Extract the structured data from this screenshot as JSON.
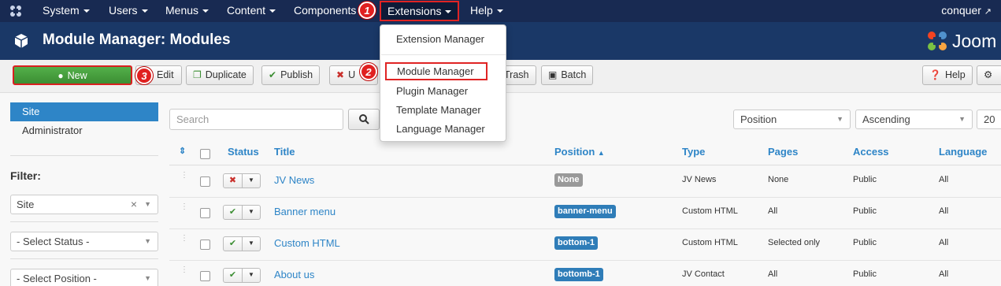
{
  "navbar": {
    "items": [
      {
        "label": "System"
      },
      {
        "label": "Users"
      },
      {
        "label": "Menus"
      },
      {
        "label": "Content"
      },
      {
        "label": "Components"
      },
      {
        "label": "Extensions"
      },
      {
        "label": "Help"
      }
    ],
    "user": "conquer"
  },
  "header": {
    "title": "Module Manager: Modules",
    "brand": "Joom"
  },
  "toolbar": {
    "new": "New",
    "edit": "Edit",
    "duplicate": "Duplicate",
    "publish": "Publish",
    "unpublish": "U",
    "trash": "Trash",
    "batch": "Batch",
    "help": "Help"
  },
  "steps": [
    "1",
    "2",
    "3"
  ],
  "dropdown": {
    "items": [
      "Extension Manager",
      "Module Manager",
      "Plugin Manager",
      "Template Manager",
      "Language Manager"
    ]
  },
  "sidebar": {
    "items": [
      "Site",
      "Administrator"
    ],
    "filter_label": "Filter:",
    "client_select": "Site",
    "status_select": "- Select Status -",
    "position_select": "- Select Position -"
  },
  "search": {
    "placeholder": "Search"
  },
  "list_controls": {
    "ordering": "Position",
    "direction": "Ascending",
    "limit": "20"
  },
  "table": {
    "headers": {
      "status": "Status",
      "title": "Title",
      "position": "Position",
      "type": "Type",
      "pages": "Pages",
      "access": "Access",
      "language": "Language"
    },
    "rows": [
      {
        "title": "JV News",
        "position": "None",
        "type": "JV News",
        "pages": "None",
        "access": "Public",
        "language": "All",
        "status": "unpublished"
      },
      {
        "title": "Banner menu",
        "position": "banner-menu",
        "type": "Custom HTML",
        "pages": "All",
        "access": "Public",
        "language": "All",
        "status": "published"
      },
      {
        "title": "Custom HTML",
        "position": "bottom-1",
        "type": "Custom HTML",
        "pages": "Selected only",
        "access": "Public",
        "language": "All",
        "status": "published"
      },
      {
        "title": "About us",
        "position": "bottomb-1",
        "type": "JV Contact",
        "pages": "All",
        "access": "Public",
        "language": "All",
        "status": "published"
      }
    ]
  },
  "colors": {
    "navbar": "#182a52",
    "header": "#1a3867",
    "accent": "#2e85c7",
    "new_button": "#46a03d",
    "highlight": "#e02424"
  }
}
